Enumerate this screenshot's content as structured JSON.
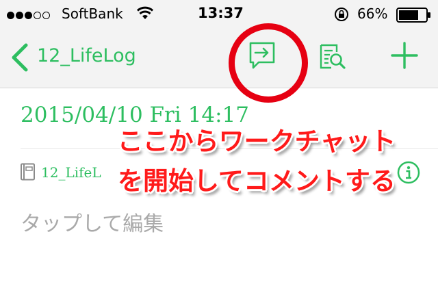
{
  "status_bar": {
    "carrier": "SoftBank",
    "time": "13:37",
    "battery": "66%",
    "signal_bars_filled": 3,
    "signal_bars_total": 5
  },
  "nav": {
    "back_label": "12_LifeLog"
  },
  "note": {
    "date": "2015/04/10 Fri 14:17",
    "notebook": "12_LifeL",
    "placeholder": "タップして編集"
  },
  "annotation": {
    "line1": "ここからワークチャット",
    "line2": "を開始してコメントする"
  },
  "colors": {
    "accent": "#2dbe60",
    "highlight": "#e60012"
  }
}
